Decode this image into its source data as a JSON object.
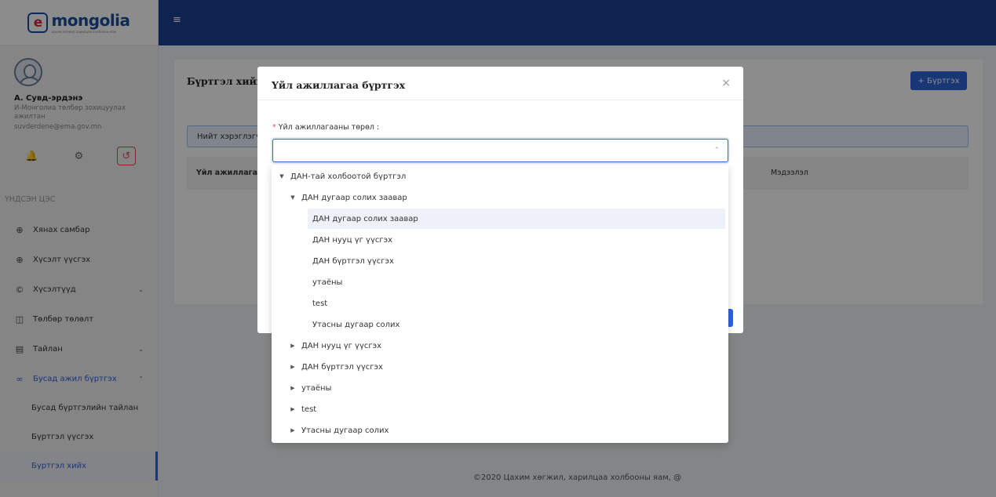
{
  "logo": {
    "letter": "e",
    "text": "mongolia",
    "tagline": "цахим хөгжил харилцаа холбооны яам"
  },
  "profile": {
    "name": "А. Сувд-эрдэнэ",
    "role": "И-Монголиа төлбөр зохицуулах ажилтан",
    "email": "suvderdene@ema.gov.mn"
  },
  "sidebar": {
    "section_title": "ҮНДСЭН ЦЭС",
    "items": [
      {
        "label": "Хянах самбар"
      },
      {
        "label": "Хүсэлт үүсгэх"
      },
      {
        "label": "Хүсэлтүүд"
      },
      {
        "label": "Төлбөр төлөлт"
      },
      {
        "label": "Тайлан"
      },
      {
        "label": "Бусад ажил бүртгэх"
      }
    ],
    "sub_items": [
      {
        "label": "Бусад бүртгэлийн тайлан"
      },
      {
        "label": "Бүртгэл үүсгэх"
      },
      {
        "label": "Бүртгэл хийх"
      }
    ]
  },
  "main": {
    "title": "Бүртгэл хийх",
    "add_button": "+ Бүртгэх",
    "info_text": "Нийт хэрэглэгч",
    "columns": [
      "Үйл ажиллагаа",
      "Мэдээлэл"
    ]
  },
  "footer": "©2020 Цахим хөгжил, харилцаа холбооны яам, @",
  "modal": {
    "title": "Үйл ажиллагаа бүртгэх",
    "close": "×",
    "field_label": "Үйл ажиллагааны төрөл :",
    "select_value": ""
  },
  "tree": {
    "root": "ДАН-тай холбоотой бүртгэл",
    "expanded": "ДАН дугаар солих заавар",
    "leaves": [
      "ДАН дугаар солих заавар",
      "ДАН нууц үг үүсгэх",
      "ДАН бүртгэл үүсгэх",
      "утаёны",
      "test",
      "Утасны дугаар солих"
    ],
    "collapsed": [
      "ДАН нууц үг үүсгэх",
      "ДАН бүртгэл үүсгэх",
      "утаёны",
      "test",
      "Утасны дугаар солих"
    ],
    "selected_leaf": "ДАН дугаар солих заавар"
  },
  "colors": {
    "primary": "#2f63d8",
    "header": "#1e3f93",
    "danger": "#e04b5a"
  }
}
